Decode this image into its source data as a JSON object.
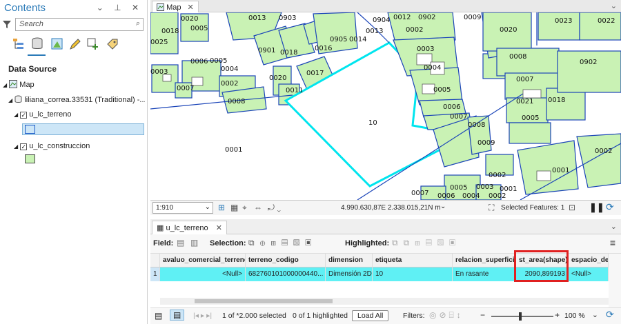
{
  "contents": {
    "title": "Contents",
    "search_placeholder": "Search",
    "data_source": "Data Source",
    "map_label": "Map",
    "database": "liliana_correa.33531 (Traditional) -...",
    "layer1": "u_lc_terreno",
    "layer2": "u_lc_construccion"
  },
  "map": {
    "tab": "Map",
    "labels": {
      "l1": "0013",
      "l2": "0903",
      "l3": "0904",
      "l4": "0012",
      "l5": "0902",
      "l6": "0009",
      "l7": "0020",
      "l8": "0018",
      "l9": "0005",
      "l10": "0025",
      "l11": "0020",
      "l12": "0023",
      "l13": "0022",
      "l14": "0002",
      "l15": "0013",
      "l16": "0905",
      "l17": "0014",
      "l18": "0016",
      "l19": "0901",
      "l20": "0018",
      "l21": "0003",
      "l22": "0006",
      "l23": "0005",
      "l24": "0004",
      "l25": "0003",
      "l26": "0008",
      "l27": "0902",
      "l28": "0020",
      "l29": "0017",
      "l30": "0004",
      "l31": "0007",
      "l32": "0002",
      "l33": "0011",
      "l34": "0005",
      "l35": "0007",
      "l36": "0008",
      "l37": "0021",
      "l38": "0018",
      "l39": "0006",
      "l40": "0007",
      "l41": "0005",
      "l42": "10",
      "l43": "0008",
      "l44": "0009",
      "l45": "0001",
      "l46": "0002",
      "l47": "0001",
      "l48": "0002",
      "l49": "0007",
      "l50": "0005",
      "l51": "0003",
      "l52": "0006",
      "l53": "0004",
      "l54": "0001",
      "l55": "0002"
    }
  },
  "status": {
    "scale": "1:910",
    "coords": "4.990.630,87E 2.338.015,21N m",
    "selected_features": "Selected Features: 1"
  },
  "table": {
    "tab": "u_lc_terreno",
    "field_label": "Field:",
    "selection_label": "Selection:",
    "highlighted_label": "Highlighted:",
    "columns": [
      "avaluo_comercial_terreno",
      "terreno_codigo",
      "dimension",
      "etiqueta",
      "relacion_superficie",
      "st_area(shape)",
      "espacio_de_n"
    ],
    "row_num": "1",
    "row": [
      "<Null>",
      "682760101000000440...",
      "Dimensión 2D",
      "10",
      "En rasante",
      "2090,899193",
      "<Null>"
    ]
  },
  "bottom": {
    "selected_text": "1 of *2.000 selected",
    "highlighted_text": "0 of 1 highlighted",
    "load_all": "Load All",
    "filters": "Filters:",
    "zoom": "100 %"
  },
  "colors": {
    "parcel_fill": "#c9f2b4",
    "selected": "#00e5ee",
    "highlight_row": "#5ff0f4",
    "accent": "#2a7ab8"
  }
}
